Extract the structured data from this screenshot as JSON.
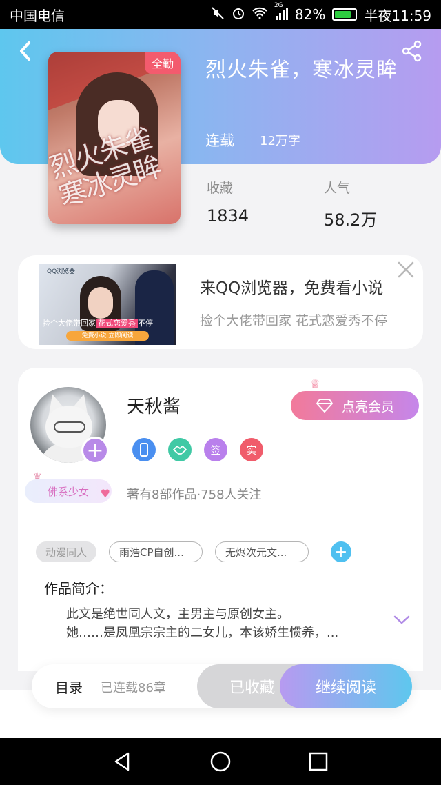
{
  "status_bar": {
    "carrier": "中国电信",
    "network": "2G",
    "battery": "82%",
    "battery_level": 0.82,
    "time": "半夜11:59"
  },
  "book": {
    "badge": "全勤",
    "cover_art_text": "烈火朱雀寒冰灵眸",
    "title": "烈火朱雀，寒冰灵眸",
    "status": "连载",
    "word_count": "12万字",
    "stats": [
      {
        "label": "收藏",
        "value": "1834"
      },
      {
        "label": "人气",
        "value": "58.2万"
      }
    ]
  },
  "ad": {
    "image_logo": "QQ浏览器",
    "image_banner_prefix": "捡个大佬带回家",
    "image_banner_highlight": "花式恋爱秀",
    "image_banner_suffix": "不停",
    "image_cta": "免费小说 立即阅读",
    "title": "来QQ浏览器，免费看小说",
    "subtitle": "捡个大佬带回家 花式恋爱秀不停"
  },
  "author": {
    "name": "天秋酱",
    "tag_badge": "佛系少女",
    "vip_button": "点亮会员",
    "badges": [
      {
        "icon": "phone-badge-icon",
        "text": ""
      },
      {
        "icon": "handshake-badge-icon",
        "text": ""
      },
      {
        "icon": "signed-badge-icon",
        "text": "签"
      },
      {
        "icon": "verified-badge-icon",
        "text": "实"
      }
    ],
    "stat": "著有8部作品·758人关注"
  },
  "tags": [
    "动漫同人",
    "雨浩CP自创...",
    "无烬次元文..."
  ],
  "intro": {
    "label": "作品简介：",
    "line1": "此文是绝世同人文，主男主与原创女主。",
    "line2": "她……是凤凰宗宗主的二女儿，本该娇生惯养，..."
  },
  "action_bar": {
    "toc_label": "目录",
    "chapter_count": "已连载86章",
    "collected_label": "已收藏",
    "read_label": "继续阅读"
  },
  "colors": {
    "header_start": "#5ec7ee",
    "header_end": "#b69cf0",
    "vip_start": "#f27a9a",
    "vip_end": "#c586ea",
    "accent_purple": "#b88ae8"
  }
}
